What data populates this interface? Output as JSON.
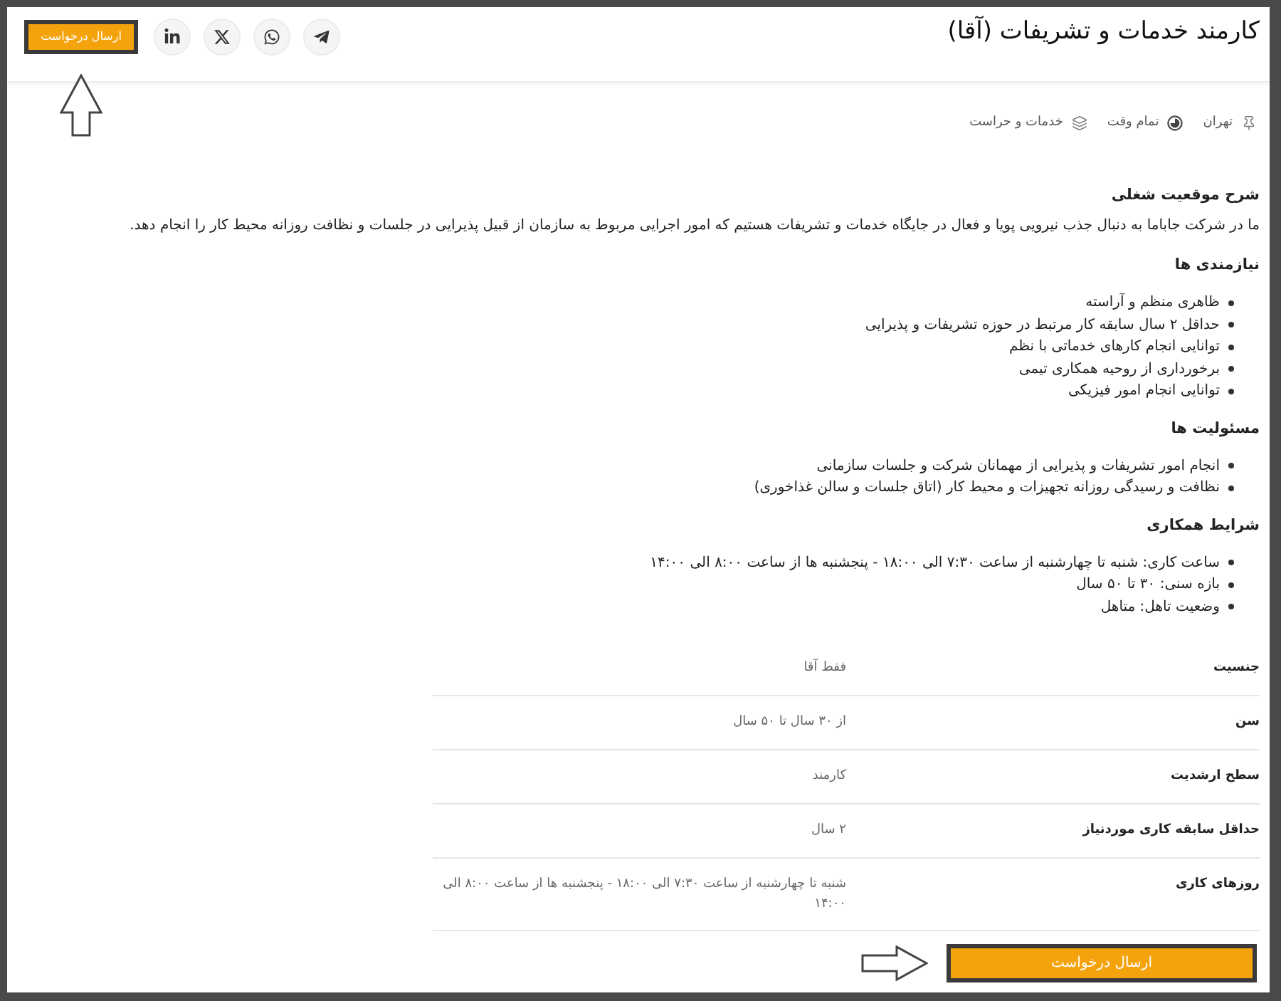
{
  "header": {
    "title": "کارمند خدمات و تشریفات (آقا)",
    "apply_button": "ارسال درخواست"
  },
  "meta": [
    {
      "kind": "location",
      "text": "تهران"
    },
    {
      "kind": "schedule",
      "text": "تمام وقت"
    },
    {
      "kind": "category",
      "text": "خدمات و حراست"
    }
  ],
  "sections": [
    {
      "kind": "paragraph",
      "heading": "شرح موقعیت شغلی",
      "text": "ما در شرکت جاباما به دنبال جذب نیرویی پویا و فعال در جایگاه خدمات و تشریفات هستیم که امور اجرایی مربوط به سازمان از قبیل پذیرایی در جلسات و نظافت روزانه محیط کار را انجام دهد."
    },
    {
      "kind": "list",
      "heading": "نیازمندی ها",
      "items": [
        "ظاهری منظم و آراسته",
        "حداقل ۲ سال سابقه کار مرتبط در حوزه تشریفات و پذیرایی",
        "توانایی انجام کارهای خدماتی با نظم",
        "برخورداری از روحیه همکاری تیمی",
        "توانایی انجام امور فیزیکی"
      ]
    },
    {
      "kind": "list",
      "heading": "مسئولیت ها",
      "items": [
        "انجام امور تشریفات و پذیرایی از مهمانان شرکت و جلسات سازمانی",
        "نظافت و رسیدگی روزانه تجهیزات و محیط کار (اتاق جلسات و سالن غذاخوری)"
      ]
    },
    {
      "kind": "list",
      "heading": "شرایط همکاری",
      "items": [
        "ساعت کاری: شنبه تا چهارشنبه از ساعت ۷:۳۰ الی ۱۸:۰۰ - پنجشنبه ها از ساعت ۸:۰۰ الی ۱۴:۰۰",
        "بازه سنی: ۳۰ تا ۵۰ سال",
        "وضعیت تاهل: متاهل"
      ]
    }
  ],
  "details": [
    {
      "label": "جنسیت",
      "value": "فقط آقا"
    },
    {
      "label": "سن",
      "value": "از ۳۰ سال تا ۵۰ سال"
    },
    {
      "label": "سطح ارشدیت",
      "value": "کارمند"
    },
    {
      "label": "حداقل سابقه کاری موردنیاز",
      "value": "۲ سال"
    },
    {
      "label": "روزهای کاری",
      "value": "شنبه تا چهارشنبه از ساعت ۷:۳۰ الی ۱۸:۰۰ - پنجشنبه ها از ساعت ۸:۰۰ الی ۱۴:۰۰"
    }
  ],
  "footer": {
    "apply_button": "ارسال درخواست"
  }
}
